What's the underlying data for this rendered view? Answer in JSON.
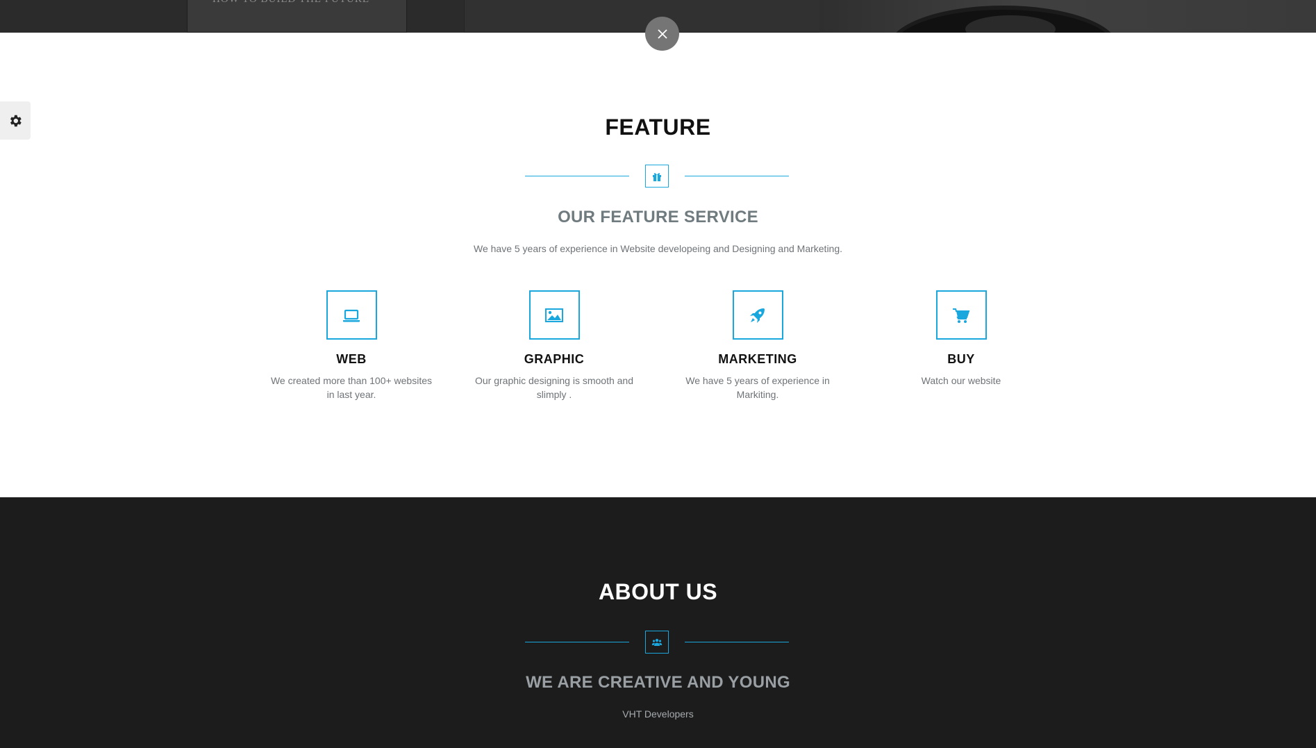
{
  "top_strip": {
    "thumb_caption": "HOW TO BUILD THE FUTURE"
  },
  "feature": {
    "title": "FEATURE",
    "divider_icon": "gift-icon",
    "subtitle": "OUR FEATURE SERVICE",
    "description": "We have 5 years of experience in Website developeing and Designing and Marketing.",
    "services": [
      {
        "icon": "laptop-icon",
        "name": "WEB",
        "text": "We created more than 100+ websites in last year."
      },
      {
        "icon": "image-icon",
        "name": "GRAPHIC",
        "text": "Our graphic designing is smooth and slimply ."
      },
      {
        "icon": "rocket-icon",
        "name": "MARKETING",
        "text": "We have 5 years of experience in Markiting."
      },
      {
        "icon": "cart-icon",
        "name": "BUY",
        "text": "Watch our website"
      }
    ]
  },
  "about": {
    "title": "ABOUT US",
    "divider_icon": "users-icon",
    "subtitle": "WE ARE CREATIVE AND YOUNG",
    "description": "VHT Developers"
  },
  "controls": {
    "close_icon": "close-icon",
    "settings_icon": "gear-icon"
  },
  "colors": {
    "accent": "#1aa7dd",
    "heading_dark": "#111111",
    "subtitle_gray": "#6f7b7f",
    "text_gray": "#6e7377",
    "dark_bg": "#1c1c1d",
    "close_bg": "#757575"
  }
}
